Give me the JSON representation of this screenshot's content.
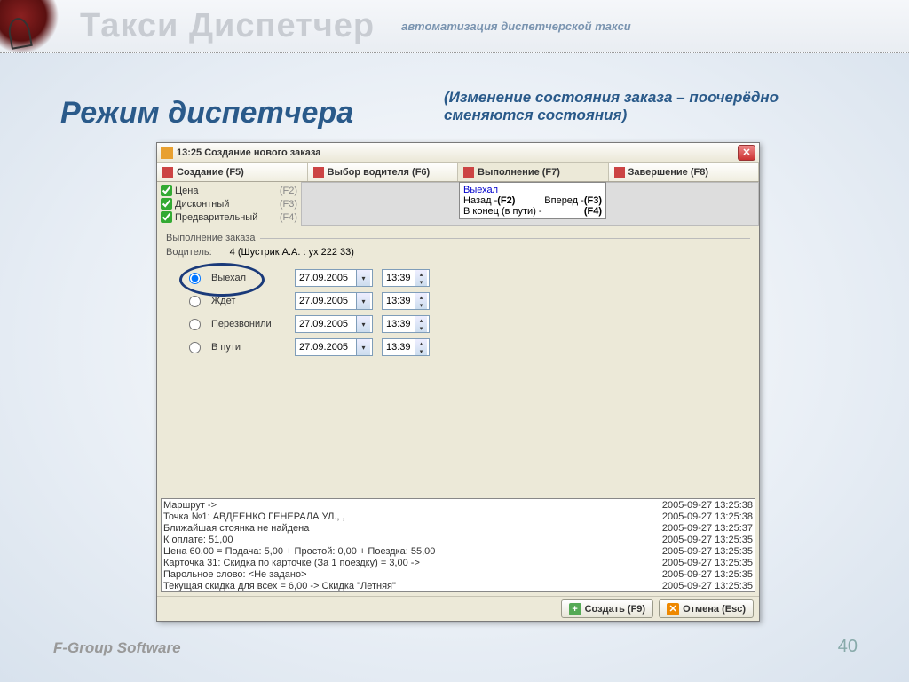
{
  "header": {
    "brand": "Такси Диспетчер",
    "tagline": "автоматизация диспетчерской такси"
  },
  "page": {
    "title": "Режим диспетчера",
    "subtitle": "(Изменение состояния заказа – поочерёдно сменяются состояния)",
    "footer": "F-Group Software",
    "number": "40"
  },
  "window": {
    "title": "13:25 Создание нового заказа",
    "tabs": [
      {
        "label": "Создание (F5)"
      },
      {
        "label": "Выбор водителя (F6)"
      },
      {
        "label": "Выполнение (F7)"
      },
      {
        "label": "Завершение (F8)"
      }
    ],
    "checks": [
      {
        "label": "Цена",
        "hot": "(F2)",
        "checked": true
      },
      {
        "label": "Дисконтный",
        "hot": "(F3)",
        "checked": true
      },
      {
        "label": "Предварительный",
        "hot": "(F4)",
        "checked": true
      }
    ],
    "popup": {
      "link": "Выехал",
      "rows": [
        {
          "l": "Назад -",
          "h": "(F2)",
          "r": "Вперед -",
          "rh": "(F3)"
        },
        {
          "l": "В конец (в пути) -",
          "h": "(F4)"
        }
      ]
    },
    "section": "Выполнение заказа",
    "driver": {
      "label": "Водитель:",
      "value": "4 (Шустрик А.А. : ух 222 33)"
    },
    "statuses": [
      {
        "label": "Выехал",
        "date": "27.09.2005",
        "time": "13:39",
        "checked": true
      },
      {
        "label": "Ждет",
        "date": "27.09.2005",
        "time": "13:39",
        "checked": false
      },
      {
        "label": "Перезвонили",
        "date": "27.09.2005",
        "time": "13:39",
        "checked": false
      },
      {
        "label": "В пути",
        "date": "27.09.2005",
        "time": "13:39",
        "checked": false
      }
    ],
    "log": [
      {
        "t": "Маршрут ->",
        "d": "2005-09-27 13:25:38"
      },
      {
        "t": "Точка №1: АВДЕЕНКО ГЕНЕРАЛА УЛ., ,",
        "d": "2005-09-27 13:25:38"
      },
      {
        "t": "Ближайшая стоянка не найдена",
        "d": "2005-09-27 13:25:37"
      },
      {
        "t": "К оплате: 51,00",
        "d": "2005-09-27 13:25:35"
      },
      {
        "t": "Цена 60,00 = Подача: 5,00 + Простой: 0,00 + Поездка: 55,00",
        "d": "2005-09-27 13:25:35"
      },
      {
        "t": "Карточка 31: Скидка по карточке (За 1 поездку) = 3,00 ->",
        "d": "2005-09-27 13:25:35"
      },
      {
        "t": "Парольное слово: <Не задано>",
        "d": "2005-09-27 13:25:35"
      },
      {
        "t": "Текущая скидка для всех = 6,00 -> Скидка \"Летняя\"",
        "d": "2005-09-27 13:25:35"
      }
    ],
    "buttons": {
      "create": "Создать (F9)",
      "cancel": "Отмена (Esc)"
    }
  }
}
